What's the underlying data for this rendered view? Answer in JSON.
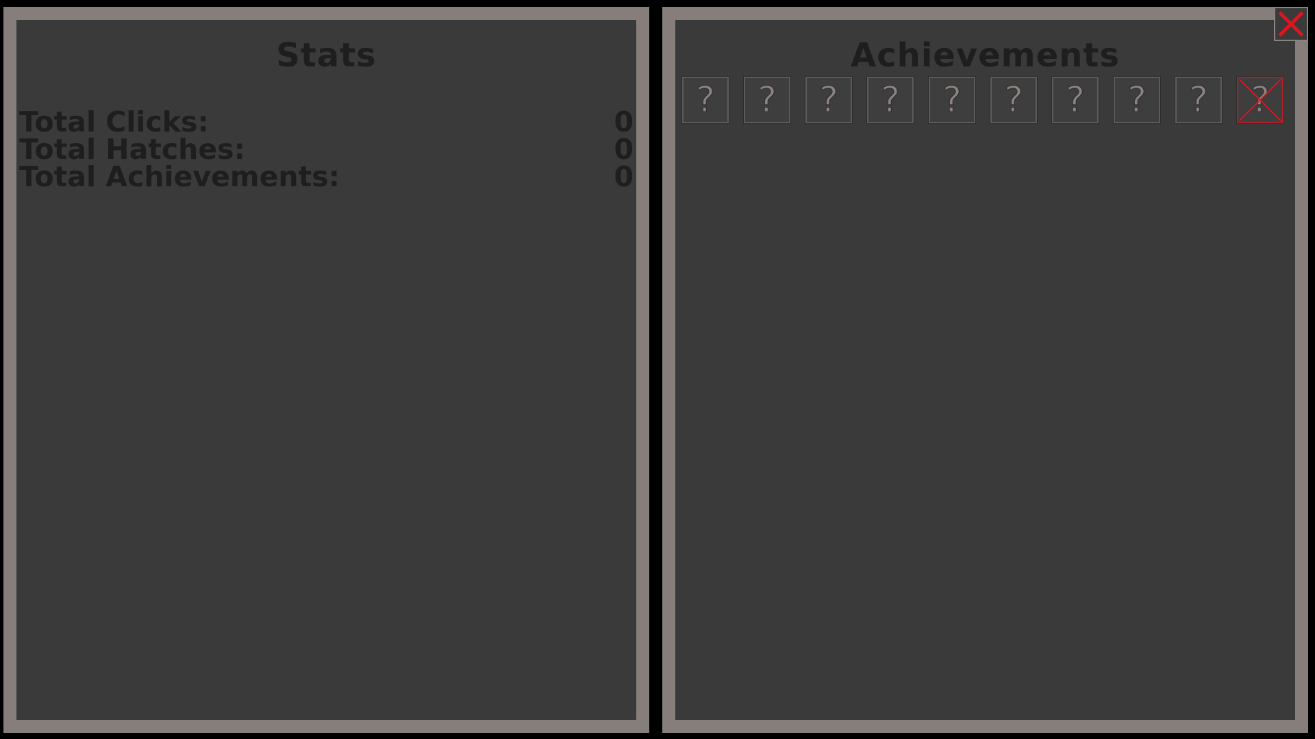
{
  "stats": {
    "title": "Stats",
    "rows": [
      {
        "label": "Total Clicks:",
        "value": "0"
      },
      {
        "label": "Total Hatches:",
        "value": "0"
      },
      {
        "label": "Total Achievements:",
        "value": "0"
      }
    ]
  },
  "achievements": {
    "title": "Achievements",
    "slots": [
      {
        "symbol": "?",
        "crossed": false
      },
      {
        "symbol": "?",
        "crossed": false
      },
      {
        "symbol": "?",
        "crossed": false
      },
      {
        "symbol": "?",
        "crossed": false
      },
      {
        "symbol": "?",
        "crossed": false
      },
      {
        "symbol": "?",
        "crossed": false
      },
      {
        "symbol": "?",
        "crossed": false
      },
      {
        "symbol": "?",
        "crossed": false
      },
      {
        "symbol": "?",
        "crossed": false
      },
      {
        "symbol": "?",
        "crossed": true
      }
    ]
  },
  "close_button": {
    "icon": "close-icon",
    "color": "#e0141e"
  },
  "colors": {
    "frame": "#867e7b",
    "panel_bg": "#3a3a3a",
    "text_dark": "#1e1e1e",
    "accent_red": "#e0141e"
  }
}
